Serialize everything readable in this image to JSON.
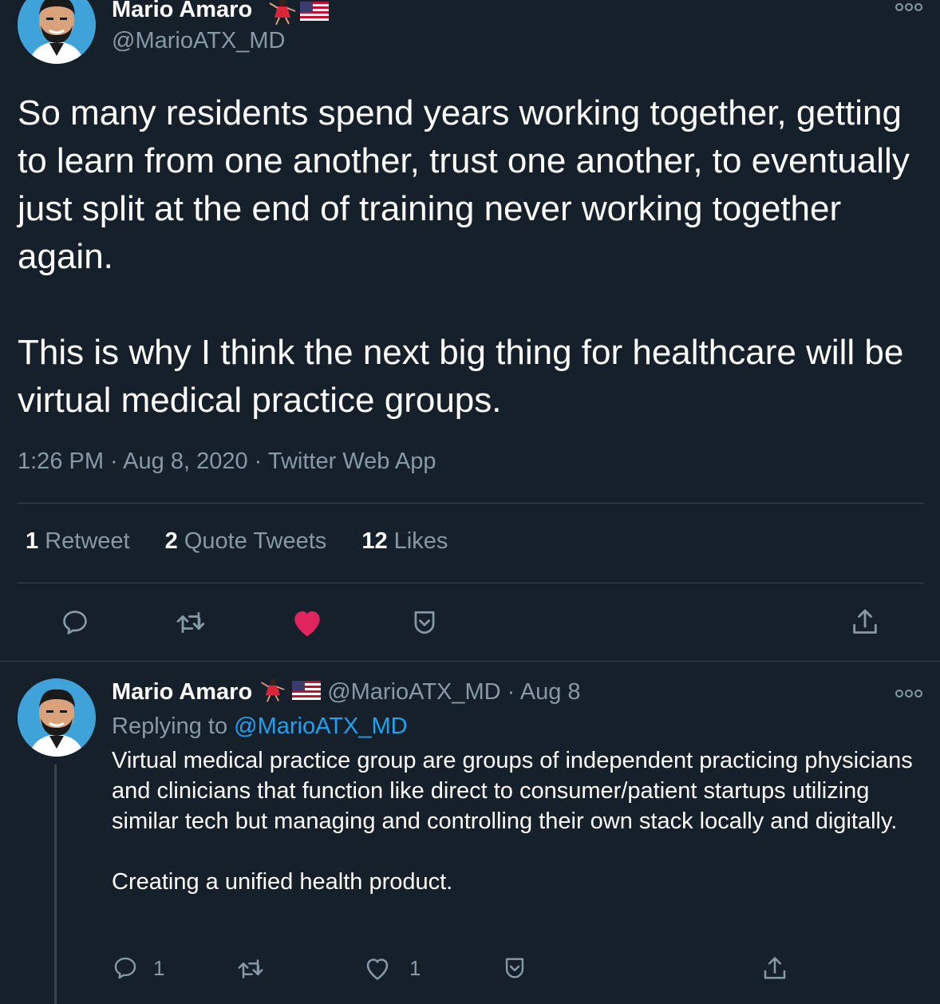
{
  "tweet": {
    "author_name": "Mario Amaro",
    "author_handle": "@MarioATX_MD",
    "text_p1": "So many residents spend years working together, getting to learn from one another, trust one another, to eventually just split at the end of training never working together again.",
    "text_p2": "This is why I think the next big thing for healthcare will be virtual medical practice groups.",
    "time": "1:26 PM · Aug 8, 2020 · Twitter Web App",
    "stats": {
      "retweets_count": "1",
      "retweets_label": "Retweet",
      "quotes_count": "2",
      "quotes_label": "Quote Tweets",
      "likes_count": "12",
      "likes_label": "Likes"
    },
    "actions": [
      "reply-icon",
      "retweet-icon",
      "heart-filled-icon",
      "bookmark-icon",
      "share-icon"
    ],
    "like_color": "#e0245e"
  },
  "reply": {
    "author_name": "Mario Amaro",
    "author_handle": "@MarioATX_MD",
    "date": "· Aug 8",
    "replying_label": "Replying to",
    "replying_handle": "@MarioATX_MD",
    "text_p1": "Virtual medical practice group are groups of independent practicing physicians and clinicians that function like direct to consumer/patient startups utilizing similar tech but managing and controlling their own stack locally and digitally.",
    "text_p2": "Creating a unified health product.",
    "reply_count": "1",
    "like_count": "1"
  },
  "colors": {
    "background": "#15202b",
    "secondary_text": "#8899a6",
    "link": "#1da1f2",
    "divider": "#38444d"
  }
}
